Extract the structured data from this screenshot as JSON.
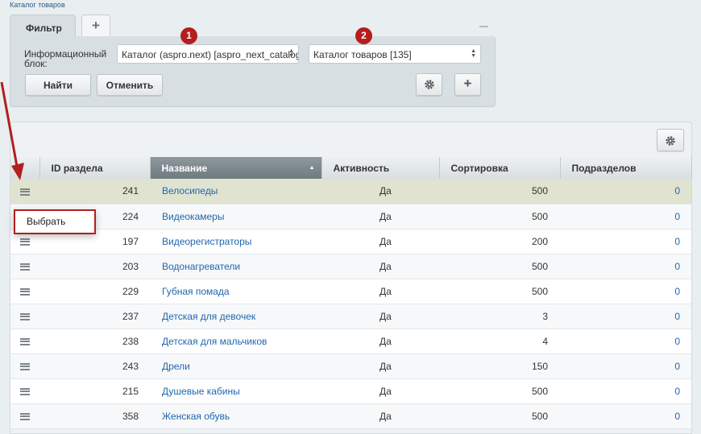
{
  "breadcrumb": "Каталог товаров",
  "filter": {
    "tab_label": "Фильтр",
    "iblock_label": "Информационный блок:",
    "select_catalog": "Каталог (aspro.next) [aspro_next_catalog]",
    "select_iblock": "Каталог товаров [135]",
    "find_label": "Найти",
    "cancel_label": "Отменить",
    "badges": [
      "1",
      "2"
    ],
    "badge_color": "#b51e1e"
  },
  "grid": {
    "columns": [
      "ID раздела",
      "Название",
      "Активность",
      "Сортировка",
      "Подразделов"
    ],
    "sorted_column": "Название",
    "rows": [
      {
        "id": "241",
        "name": "Велосипеды",
        "active": "Да",
        "sort": "500",
        "subs": "0"
      },
      {
        "id": "224",
        "name": "Видеокамеры",
        "active": "Да",
        "sort": "500",
        "subs": "0"
      },
      {
        "id": "197",
        "name": "Видеорегистраторы",
        "active": "Да",
        "sort": "200",
        "subs": "0"
      },
      {
        "id": "203",
        "name": "Водонагреватели",
        "active": "Да",
        "sort": "500",
        "subs": "0"
      },
      {
        "id": "229",
        "name": "Губная помада",
        "active": "Да",
        "sort": "500",
        "subs": "0"
      },
      {
        "id": "237",
        "name": "Детская для девочек",
        "active": "Да",
        "sort": "3",
        "subs": "0"
      },
      {
        "id": "238",
        "name": "Детская для мальчиков",
        "active": "Да",
        "sort": "4",
        "subs": "0"
      },
      {
        "id": "243",
        "name": "Дрели",
        "active": "Да",
        "sort": "150",
        "subs": "0"
      },
      {
        "id": "215",
        "name": "Душевые кабины",
        "active": "Да",
        "sort": "500",
        "subs": "0"
      },
      {
        "id": "358",
        "name": "Женская обувь",
        "active": "Да",
        "sort": "500",
        "subs": "0"
      }
    ]
  },
  "context_menu": {
    "select_label": "Выбрать"
  },
  "colors": {
    "link": "#2067b0",
    "highlight_row": "#dfe3cf",
    "annotation_red": "#b21f1f"
  }
}
